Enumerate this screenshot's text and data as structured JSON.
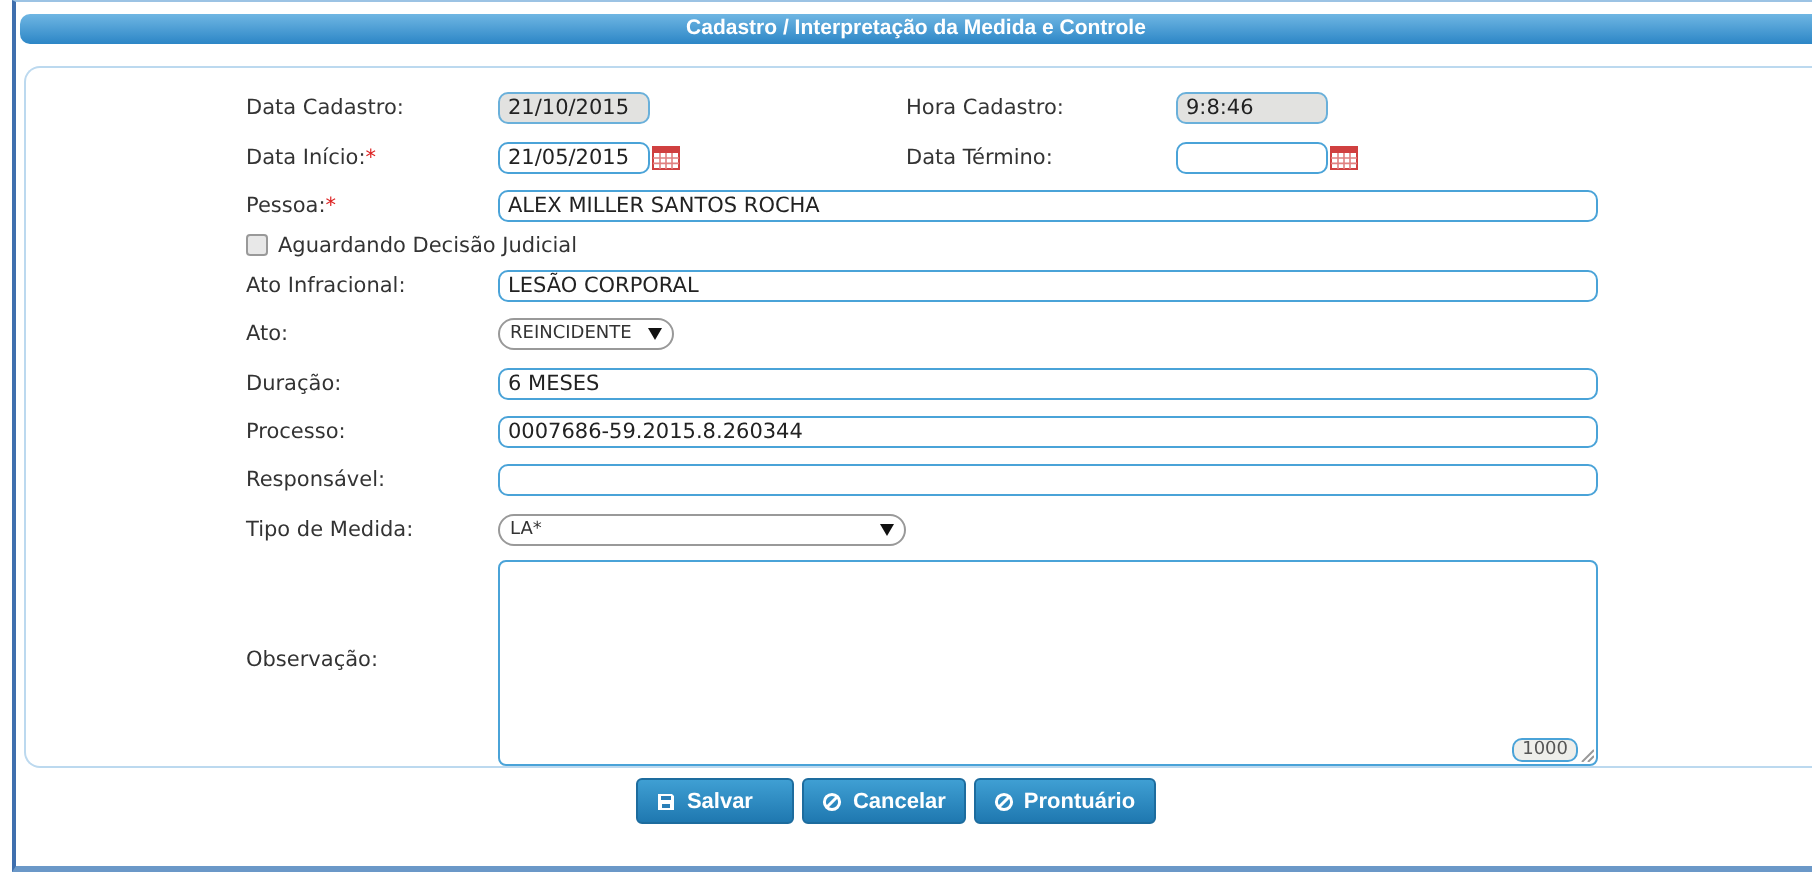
{
  "window": {
    "title": "Cadastro / Interpretação da Medida e Controle"
  },
  "rows": [
    {
      "cells": [
        {
          "kind": "date",
          "label": "Data Cadastro:",
          "value": "21/10/2015",
          "readonly": true,
          "calendar": false
        },
        {
          "kind": "date",
          "label": "Hora Cadastro:",
          "value": "9:8:46",
          "readonly": true,
          "calendar": false
        }
      ]
    },
    {
      "cells": [
        {
          "kind": "date",
          "label": "Data Início:",
          "required_mark": "*",
          "value": "21/05/2015",
          "readonly": false,
          "calendar": true
        },
        {
          "kind": "date",
          "label": "Data Término:",
          "readonly": false,
          "calendar": true
        }
      ]
    },
    {
      "cells": [
        {
          "kind": "text",
          "label": "Pessoa:",
          "required_mark": "*",
          "value": "ALEX MILLER SANTOS ROCHA",
          "readonly": false
        }
      ]
    },
    {
      "cells": [
        {
          "kind": "checkbox",
          "label": "Aguardando Decisão Judicial",
          "checked": false
        }
      ]
    },
    {
      "cells": [
        {
          "kind": "text",
          "label": "Ato Infracional:",
          "value": "LESÃO CORPORAL",
          "readonly": false
        }
      ]
    },
    {
      "cells": [
        {
          "kind": "select",
          "label": "Ato:",
          "value": "REINCIDENTE",
          "wide": false
        }
      ]
    },
    {
      "cells": [
        {
          "kind": "text",
          "label": "Duração:",
          "value": "6 MESES",
          "readonly": false
        }
      ]
    },
    {
      "cells": [
        {
          "kind": "text",
          "label": "Processo:",
          "value": "0007686-59.2015.8.260344",
          "readonly": false
        }
      ]
    },
    {
      "cells": [
        {
          "kind": "text",
          "label": "Responsável:",
          "readonly": false
        }
      ]
    },
    {
      "cells": [
        {
          "kind": "select",
          "label": "Tipo de Medida:",
          "value": "LA*",
          "wide": true
        }
      ]
    },
    {
      "cells": [
        {
          "kind": "textarea",
          "label": "Observação:",
          "counter": "1000"
        }
      ]
    }
  ],
  "buttons": [
    {
      "label": "Salvar",
      "kind": "save"
    },
    {
      "label": "Cancelar",
      "kind": "cancel"
    },
    {
      "label": "Prontuário",
      "kind": "cancel"
    }
  ]
}
